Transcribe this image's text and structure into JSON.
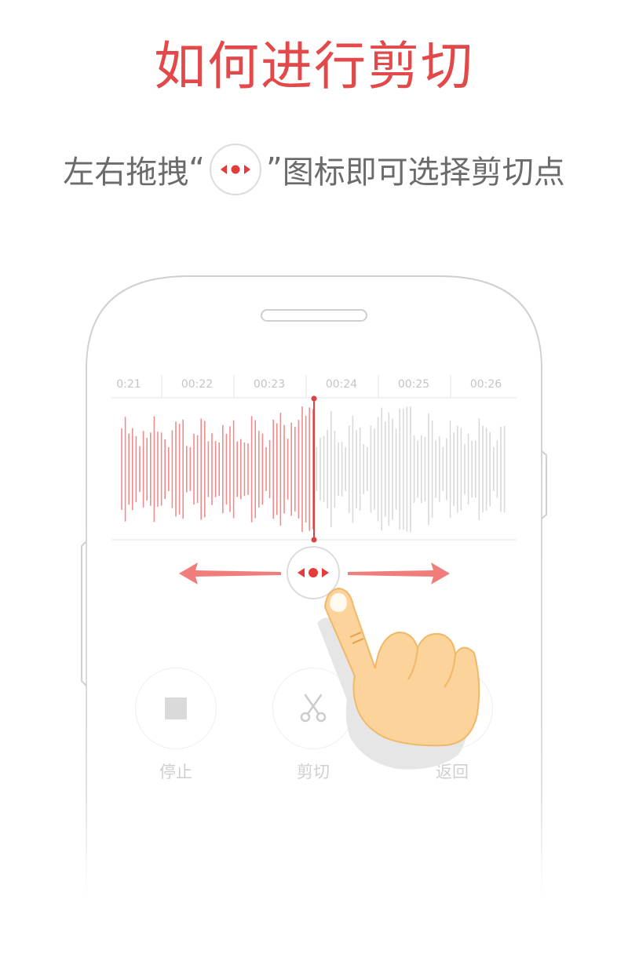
{
  "headline": "如何进行剪切",
  "instruction": {
    "before": "左右拖拽",
    "open_quote": "“",
    "close_quote": "”",
    "after": "图标即可选择剪切点"
  },
  "timeline": {
    "labels": [
      "0:21",
      "00:22",
      "00:23",
      "00:24",
      "00:25",
      "00:26"
    ],
    "playhead_time": "00:23.9"
  },
  "waveform": {
    "played_color": "#f08c8c",
    "unplayed_color": "#d9d9d9",
    "playhead_color": "#e0403e"
  },
  "controls": [
    {
      "label": "停止",
      "icon": "stop-icon"
    },
    {
      "label": "剪切",
      "icon": "scissors-icon"
    },
    {
      "label": "返回",
      "icon": "back-icon"
    }
  ],
  "colors": {
    "accent": "#e2494a",
    "arrow": "#f07c7c",
    "handle_dots": "#e53b3b",
    "hand_skin": "#fcd39a",
    "hand_outline": "#f0b868"
  }
}
